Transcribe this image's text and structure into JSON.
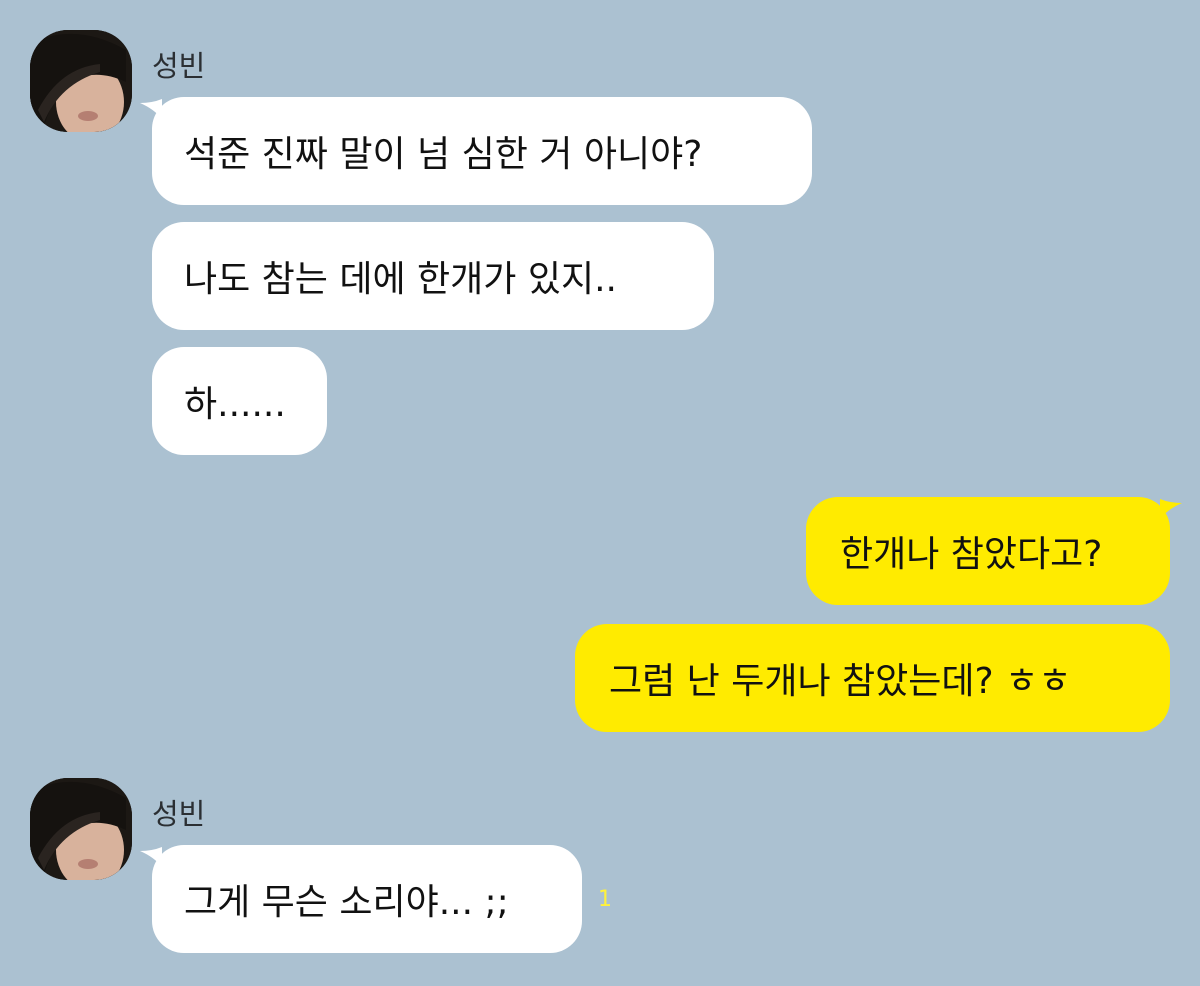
{
  "colors": {
    "background": "#abc1d1",
    "incoming_bubble": "#ffffff",
    "outgoing_bubble": "#ffeb00",
    "unread_count": "#fff23b"
  },
  "groups": [
    {
      "sender": "성빈",
      "avatar": "profile-photo",
      "messages": [
        "석준 진짜 말이 넘 심한 거 아니야?",
        "나도 참는 데에 한개가 있지..",
        "하......"
      ]
    },
    {
      "sender": "me",
      "messages": [
        "한개나 참았다고?",
        "그럼 난 두개나 참았는데? ㅎㅎ"
      ]
    },
    {
      "sender": "성빈",
      "avatar": "profile-photo",
      "messages": [
        "그게 무슨 소리야... ;;"
      ],
      "unread": "1"
    }
  ]
}
